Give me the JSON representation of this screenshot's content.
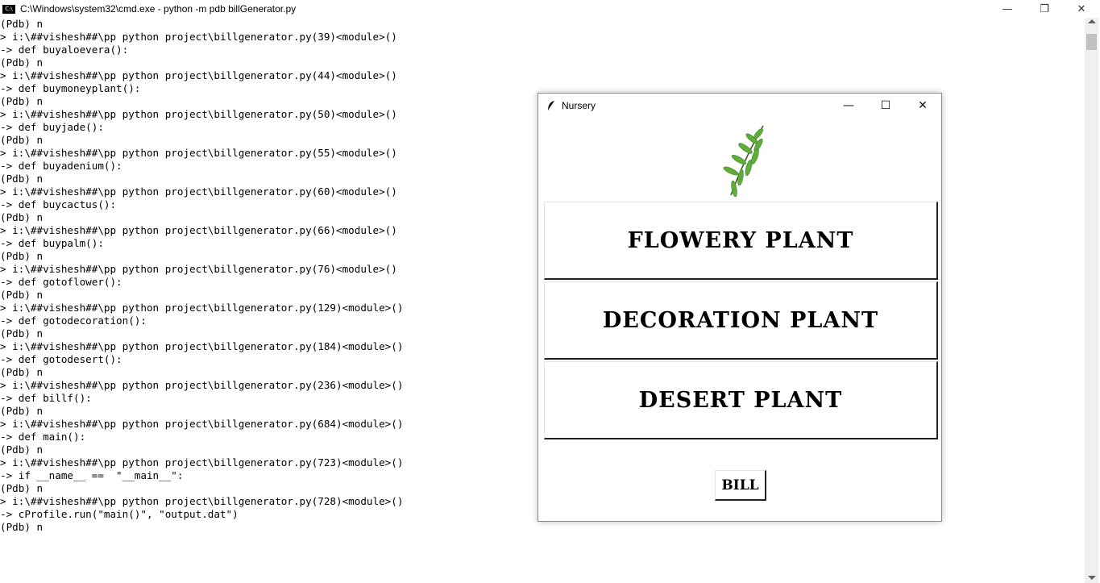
{
  "console_window": {
    "title": "C:\\Windows\\system32\\cmd.exe - python  -m pdb billGenerator.py",
    "buttons": {
      "minimize": "—",
      "restore": "❐",
      "close": "✕"
    },
    "lines": [
      "(Pdb) n",
      "> i:\\##vishesh##\\pp python project\\billgenerator.py(39)<module>()",
      "-> def buyaloevera():",
      "(Pdb) n",
      "> i:\\##vishesh##\\pp python project\\billgenerator.py(44)<module>()",
      "-> def buymoneyplant():",
      "(Pdb) n",
      "> i:\\##vishesh##\\pp python project\\billgenerator.py(50)<module>()",
      "-> def buyjade():",
      "(Pdb) n",
      "> i:\\##vishesh##\\pp python project\\billgenerator.py(55)<module>()",
      "-> def buyadenium():",
      "(Pdb) n",
      "> i:\\##vishesh##\\pp python project\\billgenerator.py(60)<module>()",
      "-> def buycactus():",
      "(Pdb) n",
      "> i:\\##vishesh##\\pp python project\\billgenerator.py(66)<module>()",
      "-> def buypalm():",
      "(Pdb) n",
      "> i:\\##vishesh##\\pp python project\\billgenerator.py(76)<module>()",
      "-> def gotoflower():",
      "(Pdb) n",
      "> i:\\##vishesh##\\pp python project\\billgenerator.py(129)<module>()",
      "-> def gotodecoration():",
      "(Pdb) n",
      "> i:\\##vishesh##\\pp python project\\billgenerator.py(184)<module>()",
      "-> def gotodesert():",
      "(Pdb) n",
      "> i:\\##vishesh##\\pp python project\\billgenerator.py(236)<module>()",
      "-> def billf():",
      "(Pdb) n",
      "> i:\\##vishesh##\\pp python project\\billgenerator.py(684)<module>()",
      "-> def main():",
      "(Pdb) n",
      "> i:\\##vishesh##\\pp python project\\billgenerator.py(723)<module>()",
      "-> if __name__ ==  \"__main__\":",
      "(Pdb) n",
      "> i:\\##vishesh##\\pp python project\\billgenerator.py(728)<module>()",
      "-> cProfile.run(\"main()\", \"output.dat\")",
      "(Pdb) n"
    ]
  },
  "tk_window": {
    "title": "Nursery",
    "buttons": {
      "minimize": "—",
      "maximize": "☐",
      "close": "✕"
    },
    "plant_buttons": [
      "FLOWERY PLANT",
      "DECORATION PLANT",
      "DESERT PLANT"
    ],
    "bill_label": "BILL"
  },
  "colors": {
    "leaf_green": "#5fae3a",
    "stem": "#3b5a2a"
  }
}
